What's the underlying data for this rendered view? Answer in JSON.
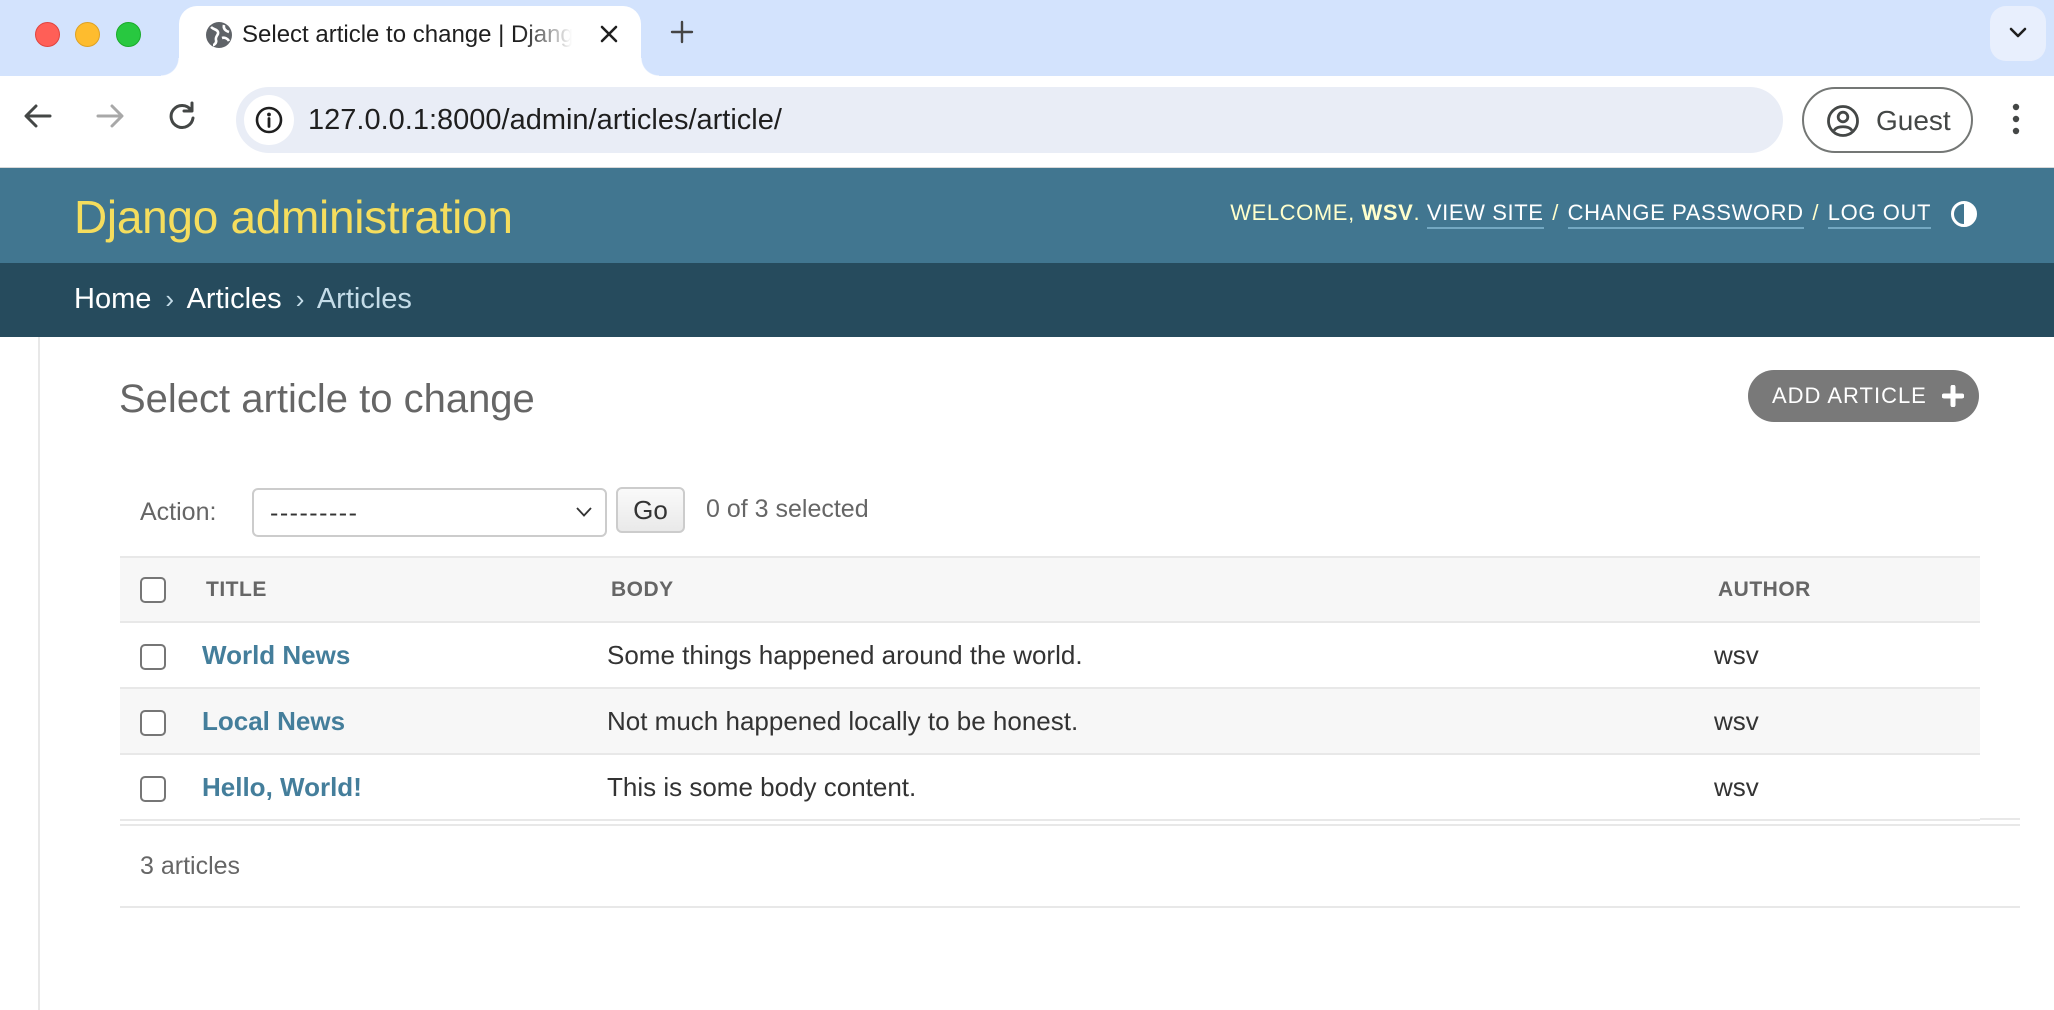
{
  "browser": {
    "tab_title": "Select article to change | Django site admin",
    "url": "127.0.0.1:8000/admin/articles/article/",
    "profile_label": "Guest",
    "icons": {
      "favicon": "globe-icon",
      "close_tab": "close-icon",
      "new_tab": "plus-icon",
      "tab_search": "chevron-down-icon",
      "back": "arrow-left-icon",
      "forward": "arrow-right-icon",
      "reload": "reload-icon",
      "site_info": "info-icon",
      "profile": "user-circle-icon",
      "menu": "kebab-menu-icon"
    }
  },
  "header": {
    "branding": "Django administration",
    "welcome_prefix": "Welcome,",
    "username": "wsv",
    "links": {
      "view_site": "View site",
      "change_password": "Change password",
      "log_out": "Log out"
    },
    "separator": "/",
    "theme_toggle_icon": "half-circle-contrast-icon"
  },
  "breadcrumbs": {
    "items": [
      "Home",
      "Articles",
      "Articles"
    ],
    "separator": "›"
  },
  "content": {
    "title": "Select article to change",
    "add_button_label": "Add article",
    "actions": {
      "label": "Action:",
      "selected_option": "---------",
      "go_label": "Go",
      "selection_count": "0 of 3 selected"
    },
    "table": {
      "columns": [
        "Title",
        "Body",
        "Author"
      ],
      "rows": [
        {
          "title": "World News",
          "body": "Some things happened around the world.",
          "author": "wsv"
        },
        {
          "title": "Local News",
          "body": "Not much happened locally to be honest.",
          "author": "wsv"
        },
        {
          "title": "Hello, World!",
          "body": "This is some body content.",
          "author": "wsv"
        }
      ]
    },
    "paginator": "3 articles"
  },
  "colors": {
    "header_bg": "#417690",
    "breadcrumb_bg": "#264b5d",
    "branding": "#f5dd5d",
    "link": "#447e9b",
    "add_button_bg": "#797979"
  }
}
